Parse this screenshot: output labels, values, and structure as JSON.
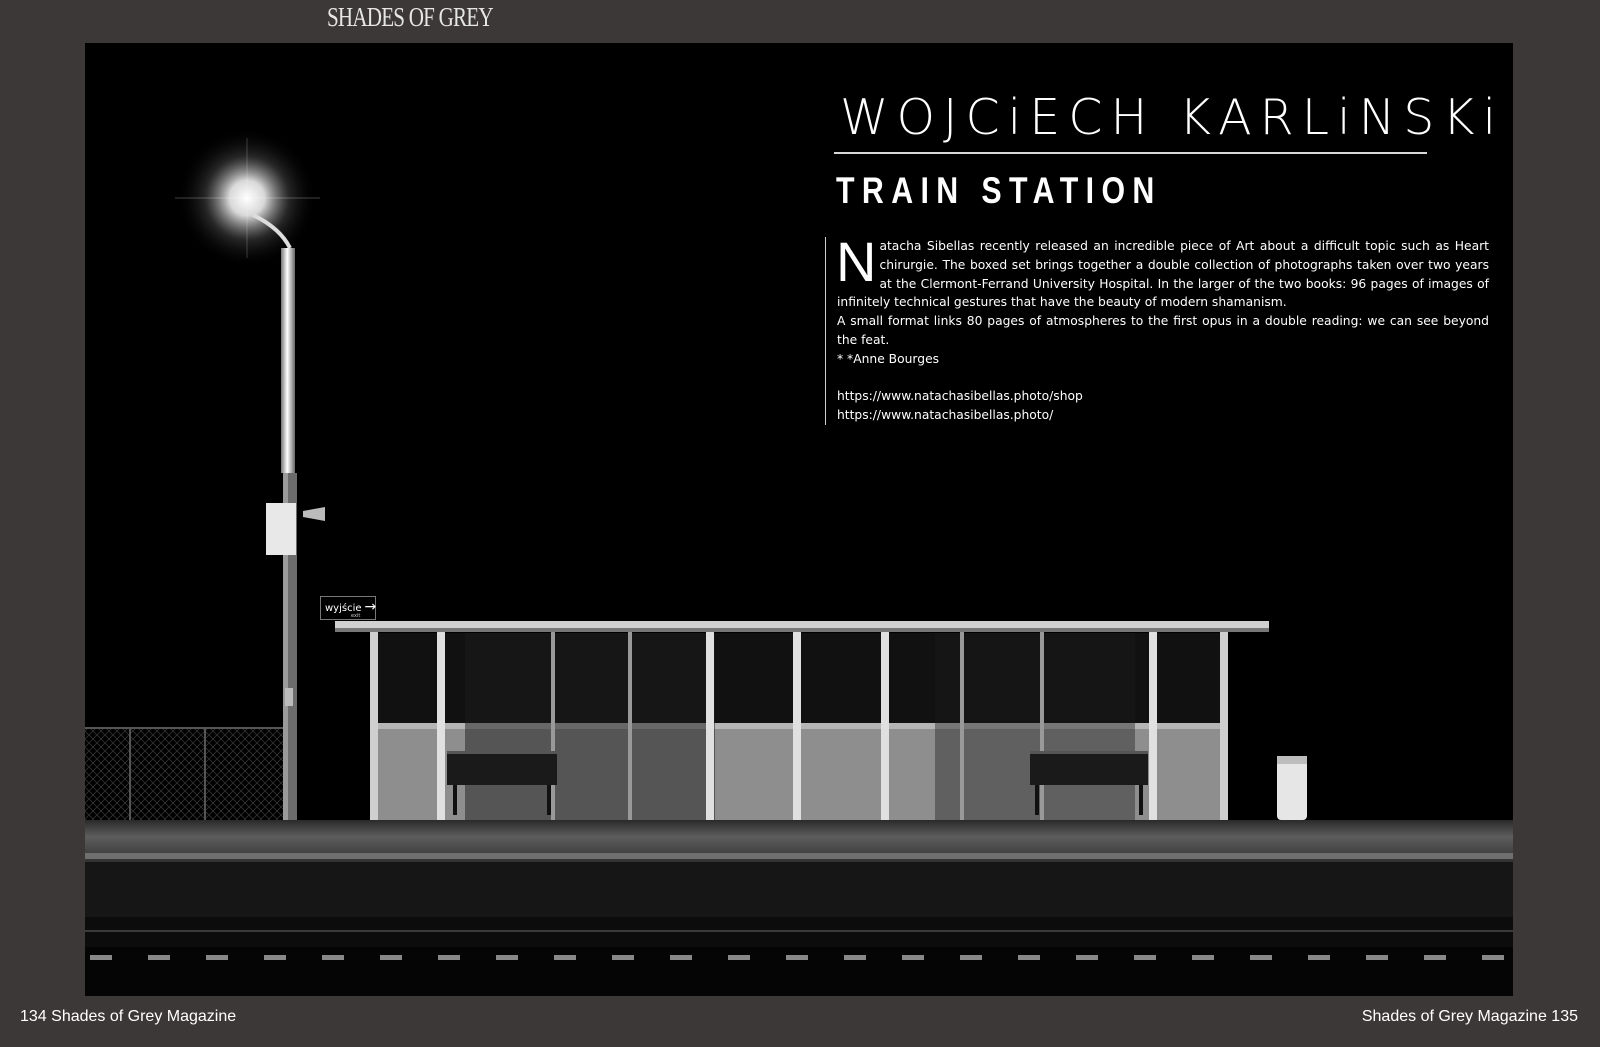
{
  "masthead": "SHADES OF GREY",
  "article": {
    "photographer": "WOJCiECH KARLiNSKi",
    "title": "TRAIN STATION",
    "dropcap": "N",
    "body_first": "atacha Sibellas recently released an incredible piece of Art about a difficult topic such as Heart chirurgie. The boxed set brings together a double collection of photographs taken over two years at the Clermont-Ferrand University Hospital. In the larger of the two books: 96 pages of images of infinitely technical gestures that have the beauty of modern shamanism.",
    "body_second": "A small format links 80 pages of atmospheres to the first opus in a double reading: we can see beyond the feat.",
    "credit": "* *Anne Bourges",
    "links": [
      "https://www.natachasibellas.photo/shop",
      "https://www.natachasibellas.photo/"
    ]
  },
  "photo": {
    "sign_text": "wyjście",
    "sign_sub": "exit"
  },
  "footer": {
    "left": "134 Shades of Grey Magazine",
    "right": "Shades of Grey Magazine 135"
  }
}
